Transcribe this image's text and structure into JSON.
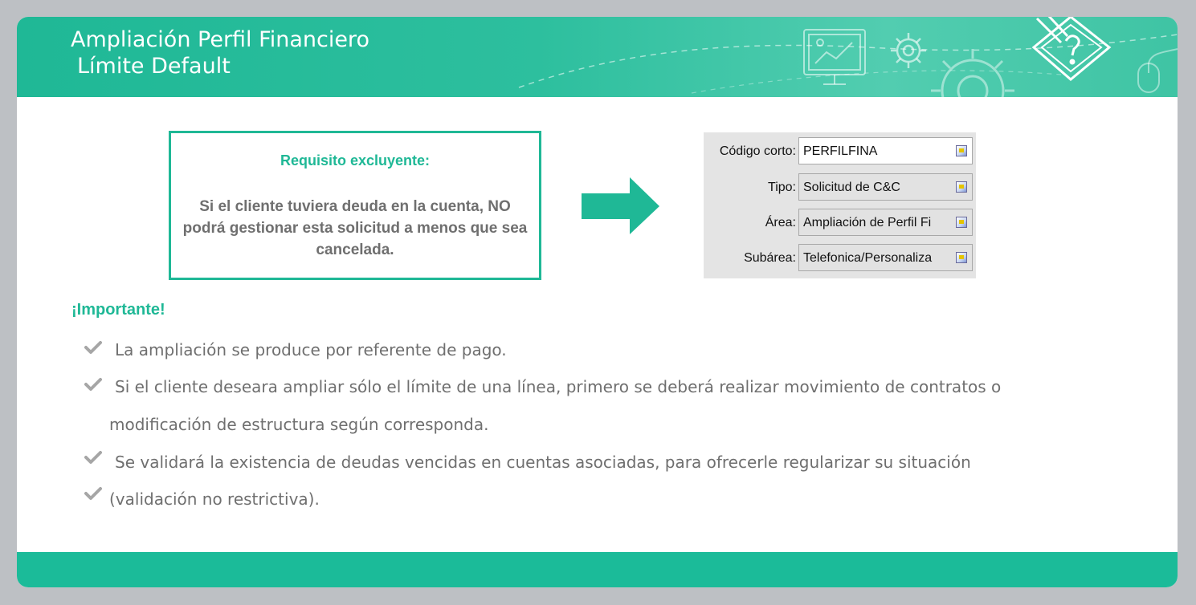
{
  "header": {
    "title_line1": "Ampliación Perfil Financiero",
    "title_line2": "Límite Default"
  },
  "requirement": {
    "title": "Requisito excluyente:",
    "body": "Si el cliente tuviera deuda en la cuenta, NO podrá gestionar esta solicitud a menos que sea cancelada."
  },
  "form": {
    "rows": [
      {
        "label": "Código corto:",
        "value": "PERFILFINA"
      },
      {
        "label": "Tipo:",
        "value": "Solicitud  de C&C"
      },
      {
        "label": "Área:",
        "value": "Ampliación de Perfil Fi"
      },
      {
        "label": "Subárea:",
        "value": "Telefonica/Personaliza"
      }
    ]
  },
  "important": {
    "heading": "¡Importante!",
    "bullets": [
      "La ampliación se produce por referente de pago.",
      "Si el cliente deseara ampliar sólo el límite de una línea, primero se deberá realizar movimiento de contratos o",
      "modificación de estructura según corresponda.",
      "Se validará la existencia de deudas vencidas en cuentas asociadas, para ofrecerle regularizar su situación",
      "(validación no restrictiva)."
    ]
  },
  "colors": {
    "accent": "#1fb896",
    "text_grey": "#6f6f6f",
    "background": "#bdc0c4"
  },
  "icons": [
    "presentation-screen-icon",
    "gear-icon",
    "large-gear-icon",
    "pencil-question-icon",
    "mouse-icon",
    "checkmark-icon",
    "right-arrow-icon",
    "dropdown-button-icon"
  ]
}
